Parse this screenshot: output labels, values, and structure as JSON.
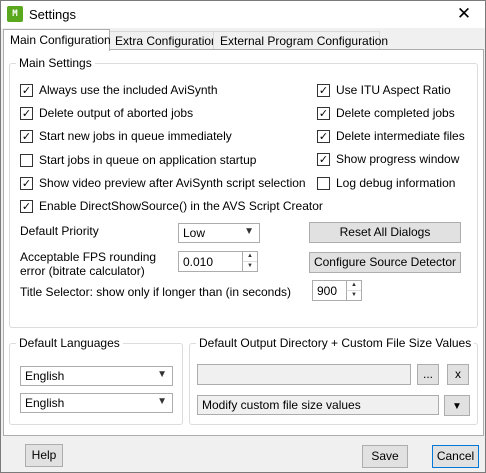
{
  "window": {
    "title": "Settings",
    "icon_text": "M"
  },
  "tabs": [
    {
      "label": "Main Configuration"
    },
    {
      "label": "Extra Configuration"
    },
    {
      "label": "External Program Configuration"
    }
  ],
  "main_settings": {
    "group_label": "Main Settings",
    "left_checks": [
      {
        "label": "Always use the included AviSynth",
        "checked": true
      },
      {
        "label": "Delete output of aborted jobs",
        "checked": true
      },
      {
        "label": "Start new jobs in queue immediately",
        "checked": true
      },
      {
        "label": "Start jobs in queue on application startup",
        "checked": false
      },
      {
        "label": "Show video preview after AviSynth script selection",
        "checked": true
      },
      {
        "label": "Enable DirectShowSource() in the AVS Script Creator",
        "checked": true
      }
    ],
    "right_checks": [
      {
        "label": "Use ITU Aspect Ratio",
        "checked": true
      },
      {
        "label": "Delete completed jobs",
        "checked": true
      },
      {
        "label": "Delete intermediate files",
        "checked": true
      },
      {
        "label": "Show progress window",
        "checked": true
      },
      {
        "label": "Log debug information",
        "checked": false
      }
    ],
    "default_priority_label": "Default Priority",
    "default_priority_value": "Low",
    "reset_dialogs_label": "Reset All Dialogs",
    "fps_label_line1": "Acceptable FPS rounding",
    "fps_label_line2": "error (bitrate calculator)",
    "fps_value": "0.010",
    "configure_source_label": "Configure Source Detector",
    "title_selector_label": "Title Selector:  show only if longer than (in seconds)",
    "title_selector_value": "900"
  },
  "languages": {
    "group_label": "Default Languages",
    "first": "English",
    "second": "English"
  },
  "output": {
    "group_label": "Default Output Directory + Custom File Size Values",
    "directory_value": "",
    "browse_label": "...",
    "clear_label": "x",
    "file_size_value": "Modify custom file size values"
  },
  "footer": {
    "help_label": "Help",
    "save_label": "Save",
    "cancel_label": "Cancel"
  },
  "check_glyph": "✓"
}
